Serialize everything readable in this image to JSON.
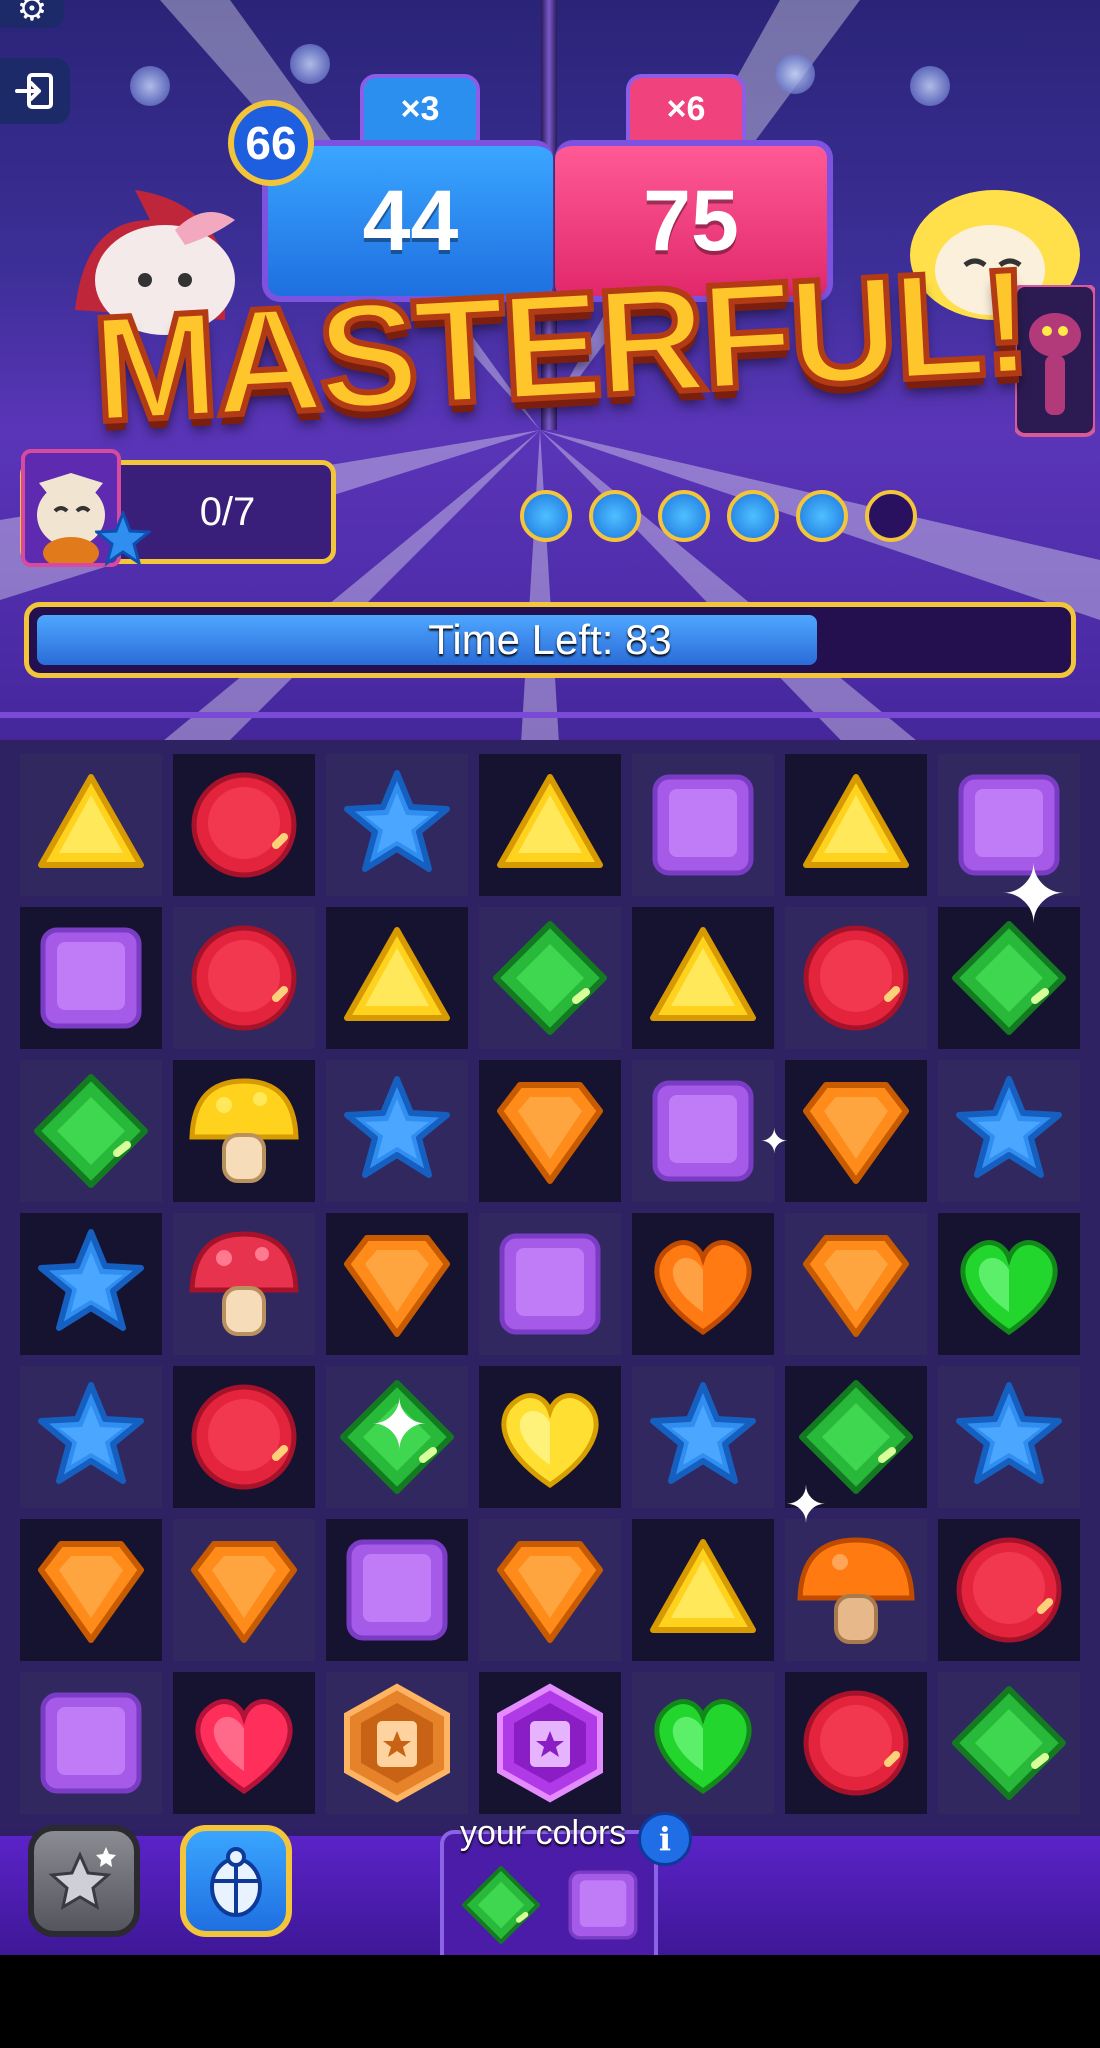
{
  "hud": {
    "left_player_level": "66",
    "left_multiplier": "×3",
    "left_score": "44",
    "right_multiplier": "×6",
    "right_score": "75"
  },
  "banner": {
    "text": "MASTERFUL!"
  },
  "collect": {
    "progress": "0/7"
  },
  "round_dots": {
    "filled": 5,
    "total": 6
  },
  "timer": {
    "label": "Time Left: 83",
    "fraction": 0.76
  },
  "board": {
    "rows": [
      [
        "yellow-triangle",
        "red-circle",
        "blue-star",
        "yellow-triangle",
        "purple-square",
        "yellow-triangle",
        "purple-square"
      ],
      [
        "purple-square",
        "red-circle",
        "yellow-triangle",
        "green-diamond",
        "yellow-triangle",
        "red-circle",
        "green-diamond"
      ],
      [
        "green-diamond",
        "yellow-mushroom",
        "blue-star",
        "orange-shield",
        "purple-square",
        "orange-shield",
        "blue-star"
      ],
      [
        "blue-star",
        "red-mushroom",
        "orange-shield",
        "purple-square",
        "orange-heart",
        "orange-shield",
        "green-heart"
      ],
      [
        "blue-star",
        "red-circle",
        "green-diamond",
        "yellow-heart",
        "blue-star",
        "green-diamond",
        "blue-star"
      ],
      [
        "orange-shield",
        "orange-shield",
        "purple-square",
        "orange-shield",
        "yellow-triangle",
        "orange-mushroom",
        "red-circle"
      ],
      [
        "purple-square",
        "red-heart",
        "orange-book-hex",
        "purple-book-hex",
        "green-heart",
        "red-circle",
        "green-diamond"
      ]
    ],
    "shading": [
      [
        "light",
        "dark",
        "light",
        "dark",
        "light",
        "dark",
        "light"
      ],
      [
        "dark",
        "light",
        "dark",
        "light",
        "dark",
        "light",
        "dark"
      ],
      [
        "light",
        "dark",
        "light",
        "dark",
        "light",
        "dark",
        "light"
      ],
      [
        "dark",
        "light",
        "dark",
        "light",
        "dark",
        "light",
        "dark"
      ],
      [
        "light",
        "dark",
        "light",
        "dark",
        "light",
        "dark",
        "light"
      ],
      [
        "dark",
        "light",
        "dark",
        "light",
        "dark",
        "light",
        "dark"
      ],
      [
        "light",
        "dark",
        "light",
        "dark",
        "light",
        "dark",
        "light"
      ]
    ]
  },
  "your_colors": {
    "label": "your colors",
    "info": "i",
    "gems": [
      "green-diamond",
      "purple-square"
    ]
  },
  "boosters": [
    "stars-booster-icon",
    "scarab-booster-icon"
  ],
  "icons": [
    "gear-icon",
    "exit-icon"
  ],
  "colors": {
    "gold": "#f3c53b",
    "timer_blue": "#2a6cd8",
    "board_bg": "#2e2262"
  }
}
